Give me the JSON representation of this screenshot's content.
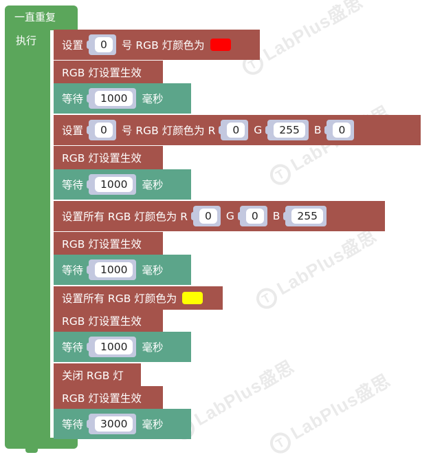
{
  "watermark": "LabPlus盛思",
  "loop": {
    "title": "一直重复",
    "do_label": "执行"
  },
  "blocks": {
    "b1": {
      "prefix": "设置",
      "index": "0",
      "mid": "号 RGB 灯颜色为",
      "color": "#ff0000"
    },
    "b2": {
      "label": "RGB 灯设置生效"
    },
    "b3": {
      "prefix": "等待",
      "value": "1000",
      "unit": "毫秒"
    },
    "b4": {
      "prefix": "设置",
      "index": "0",
      "mid": "号 RGB 灯颜色为 R",
      "r": "0",
      "g_label": "G",
      "g": "255",
      "b_label": "B",
      "b": "0"
    },
    "b5": {
      "label": "RGB 灯设置生效"
    },
    "b6": {
      "prefix": "等待",
      "value": "1000",
      "unit": "毫秒"
    },
    "b7": {
      "prefix": "设置所有 RGB 灯颜色为 R",
      "r": "0",
      "g_label": "G",
      "g": "0",
      "b_label": "B",
      "b": "255"
    },
    "b8": {
      "label": "RGB 灯设置生效"
    },
    "b9": {
      "prefix": "等待",
      "value": "1000",
      "unit": "毫秒"
    },
    "b10": {
      "prefix": "设置所有 RGB 灯颜色为",
      "color": "#ffff00"
    },
    "b11": {
      "label": "RGB 灯设置生效"
    },
    "b12": {
      "prefix": "等待",
      "value": "1000",
      "unit": "毫秒"
    },
    "b13": {
      "label": "关闭 RGB 灯"
    },
    "b14": {
      "label": "RGB 灯设置生效"
    },
    "b15": {
      "prefix": "等待",
      "value": "3000",
      "unit": "毫秒"
    }
  },
  "colors": {
    "loop": "#5ba65b",
    "rgb_block": "#a5534b",
    "wait_block": "#5ca58a",
    "input_socket": "#c3c8df"
  }
}
